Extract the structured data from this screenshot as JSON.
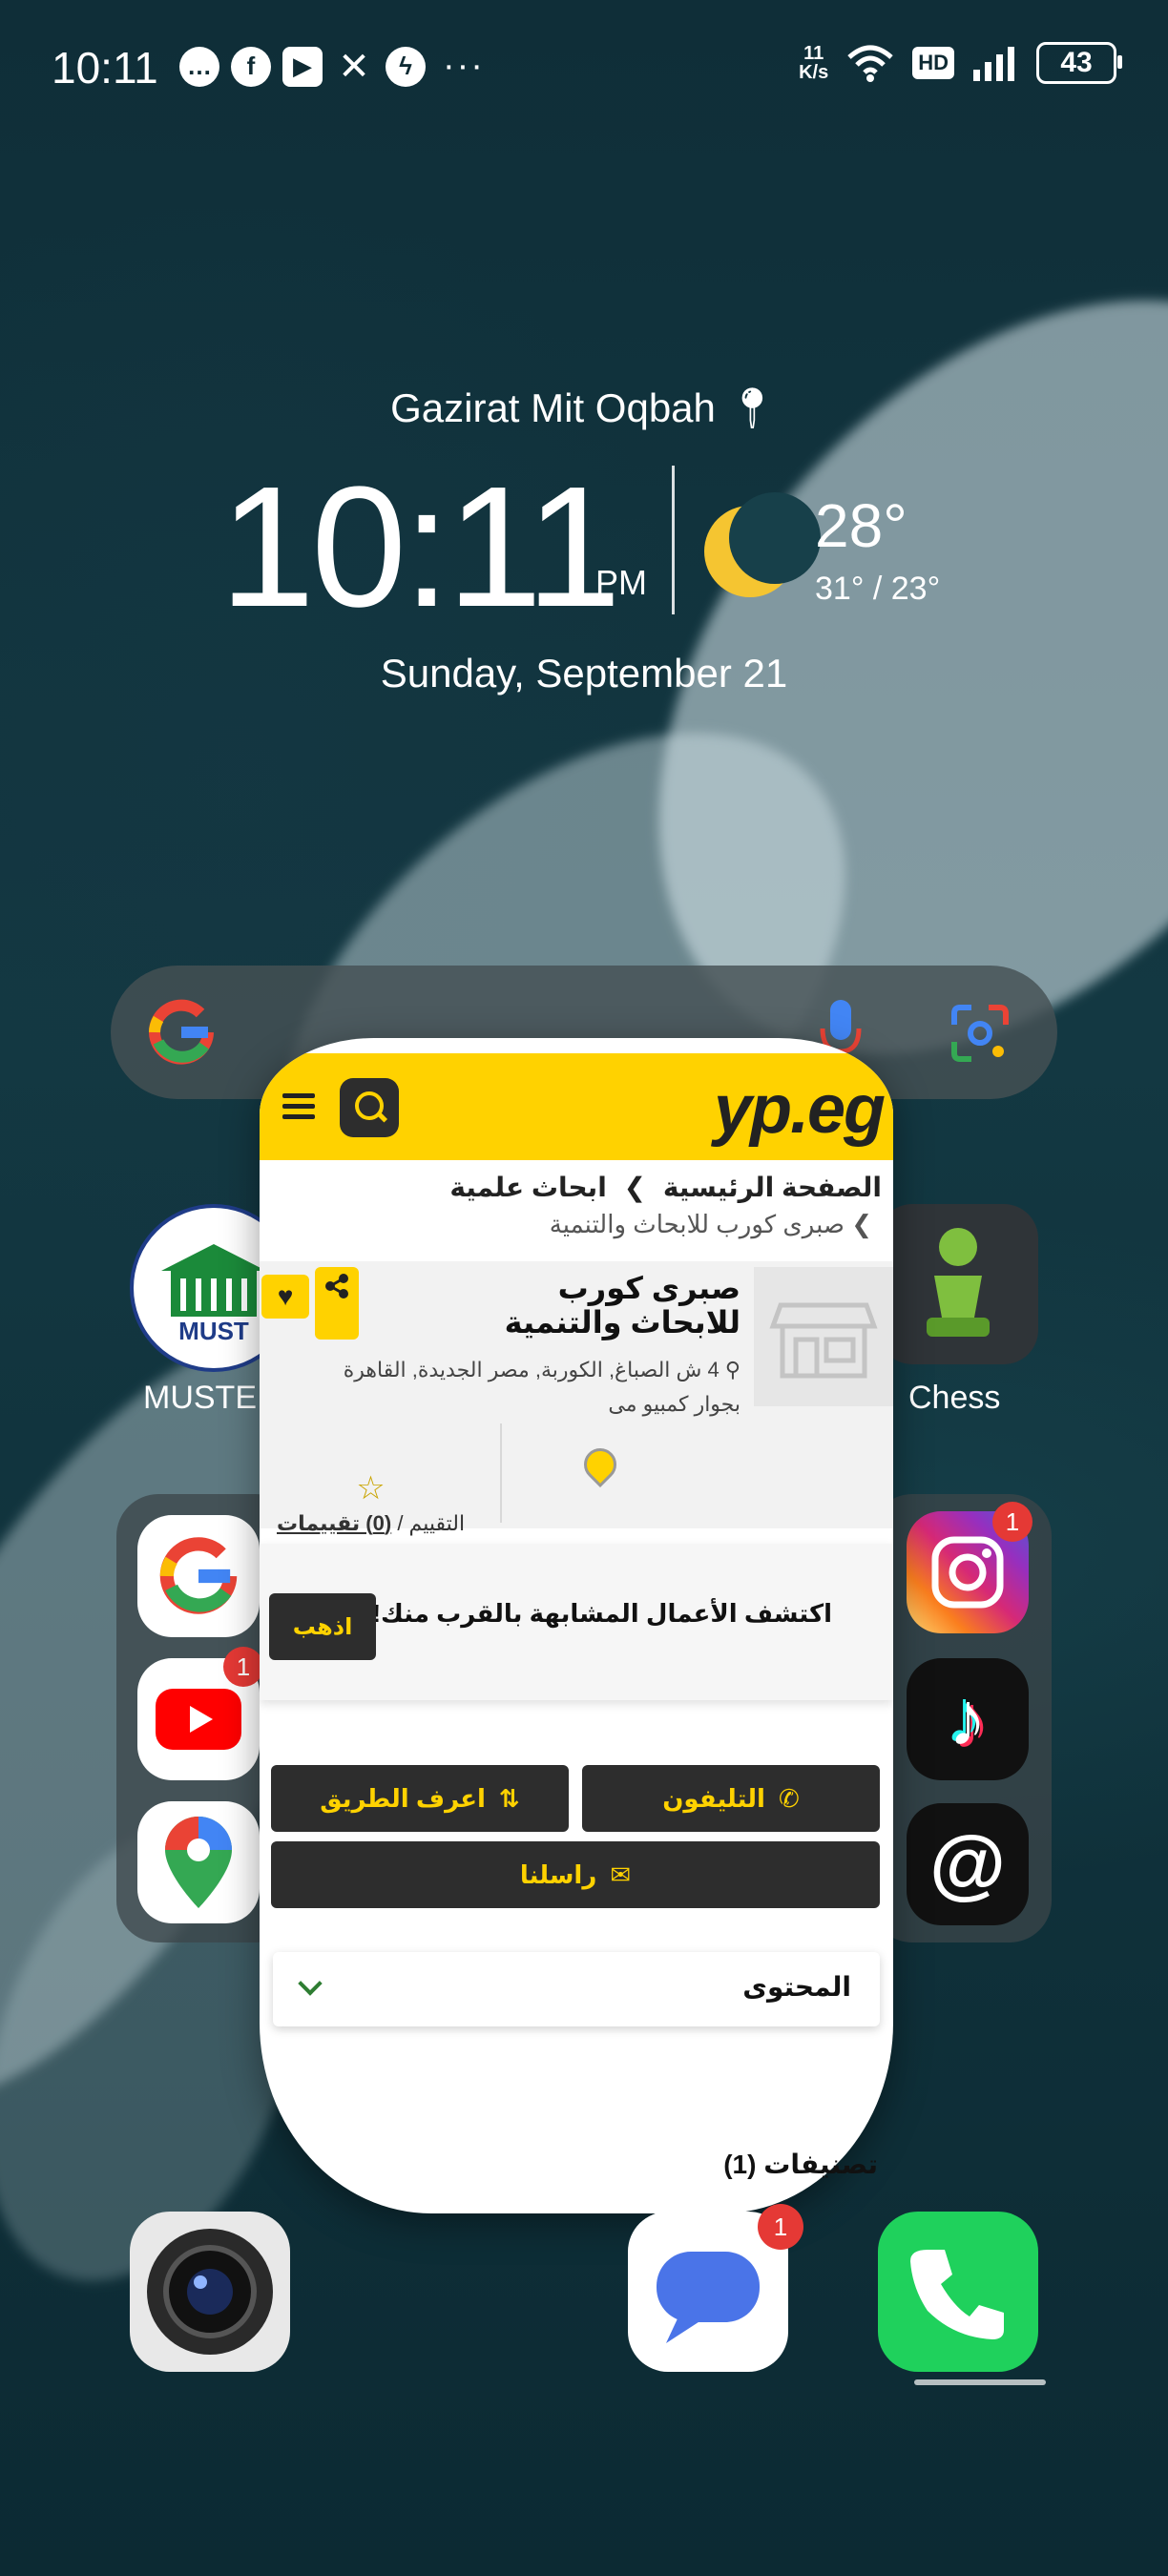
{
  "status_bar": {
    "time": "10:11",
    "notification_icons": [
      "chat-icon",
      "facebook-icon",
      "youtube-icon",
      "x-icon",
      "messenger-icon"
    ],
    "more": "···",
    "net_speed_value": "11",
    "net_speed_unit": "K/s",
    "hd_label": "HD",
    "battery": "43"
  },
  "widget": {
    "location": "Gazirat Mit Oqbah",
    "time": "10:11",
    "ampm": "PM",
    "temperature": "28°",
    "range": "31° / 23°",
    "date": "Sunday, September 21"
  },
  "home": {
    "must_label": "MUSTE",
    "chess_label": "Chess",
    "youtube_badge": "1",
    "instagram_badge": "1",
    "messages_badge": "1"
  },
  "recent_card": {
    "logo": "yp.eg",
    "breadcrumb_home": "الصفحة الرئيسية",
    "breadcrumb_sep": "❯",
    "breadcrumb_category": "ابحاث علمية",
    "breadcrumb_current": "❯ صبرى كورب للابحاث والتنمية",
    "business_name": "صبرى كورب للابحاث والتنمية",
    "address": "4 ش الصباغ, الكوربة, مصر الجديدة, القاهرة بجوار كمبيو مى",
    "rating_label": "التقييم /",
    "rating_link": "(0) تقييمات",
    "discover_text": "اكتشف الأعمال المشابهة بالقرب منك!",
    "go_button": "اذهب",
    "phone_button": "التليفون",
    "directions_button": "اعرف الطريق",
    "message_button": "راسلنا",
    "content_section": "المحتوى",
    "categories": "تصنيفات (1)"
  },
  "colors": {
    "yp_yellow": "#ffd200",
    "yp_dark": "#2d2d2d"
  }
}
